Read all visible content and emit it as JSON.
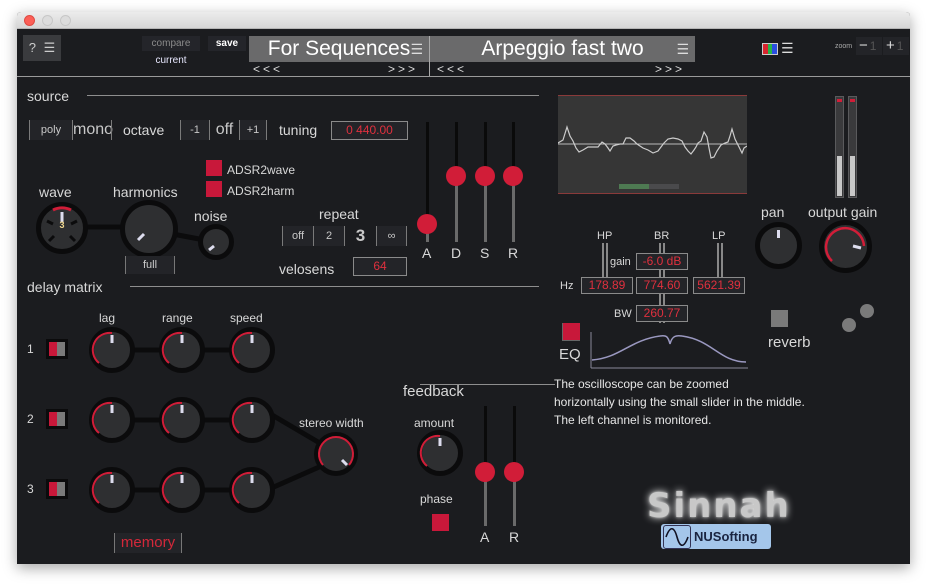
{
  "window": {
    "title": ""
  },
  "topbar": {
    "help_label": "?",
    "help_menu_icon": "hamburger-icon",
    "compare_label": "compare",
    "save_label": "save",
    "current_label": "current",
    "preset_bank": {
      "name": "For Sequences",
      "prev": "<<<",
      "next": ">>>"
    },
    "preset": {
      "name": "Arpeggio fast two",
      "prev": "<<<",
      "next": ">>>"
    },
    "color_scheme_icon": "color-scheme-icon",
    "zoom": {
      "label": "zoom",
      "minus": "−",
      "minus_value": "1",
      "plus": "+",
      "plus_value": "1"
    }
  },
  "source": {
    "title": "source",
    "voice_mode": {
      "options": [
        "poly",
        "mono"
      ],
      "selected": "mono"
    },
    "octave": {
      "label": "octave",
      "options": [
        "-1",
        "off",
        "+1"
      ],
      "selected": "off"
    },
    "tuning": {
      "label": "tuning",
      "value": "0 440.00"
    },
    "adsr2wave": {
      "label": "ADSR2wave",
      "checked": true
    },
    "adsr2harm": {
      "label": "ADSR2harm",
      "checked": true
    },
    "wave": {
      "label": "wave",
      "value": "3"
    },
    "harmonics": {
      "label": "harmonics",
      "mode": "full"
    },
    "noise": {
      "label": "noise"
    },
    "repeat": {
      "label": "repeat",
      "options": [
        "off",
        "2",
        "3",
        "∞"
      ],
      "selected": "3"
    },
    "velosens": {
      "label": "velosens",
      "value": "64"
    },
    "envelope": {
      "labels": [
        "A",
        "D",
        "S",
        "R"
      ],
      "values": [
        0.15,
        0.55,
        0.55,
        0.55
      ]
    }
  },
  "delay_matrix": {
    "title": "delay matrix",
    "columns": [
      "lag",
      "range",
      "speed"
    ],
    "rows": [
      {
        "index": "1"
      },
      {
        "index": "2"
      },
      {
        "index": "3"
      }
    ],
    "stereo_width_label": "stereo width",
    "memory_label": "memory"
  },
  "feedback": {
    "title": "feedback",
    "amount_label": "amount",
    "phase_label": "phase",
    "phase_on": true,
    "envelope": {
      "labels": [
        "A",
        "R"
      ],
      "values": [
        0.45,
        0.45
      ]
    }
  },
  "eq": {
    "hp_label": "HP",
    "br_label": "BR",
    "lp_label": "LP",
    "gain_label": "gain",
    "gain_value": "-6.0 dB",
    "hz_label": "Hz",
    "hp_value": "178.89",
    "br_value": "774.60",
    "lp_value": "5621.39",
    "bw_label": "BW",
    "bw_value": "260.77",
    "eq_label": "EQ",
    "enabled": true
  },
  "output": {
    "pan_label": "pan",
    "output_gain_label": "output gain",
    "reverb_label": "reverb",
    "meter_levels": [
      0.4,
      0.4
    ]
  },
  "info_text": [
    "The oscilloscope can be zoomed",
    "horizontally using the small slider in the middle.",
    "The left channel is monitored."
  ],
  "logo": {
    "product": "Sinnah",
    "company": "NUSofting"
  },
  "colors": {
    "accent": "#d11d38",
    "background": "#1b1c1f",
    "panel": "#2e2f31"
  }
}
